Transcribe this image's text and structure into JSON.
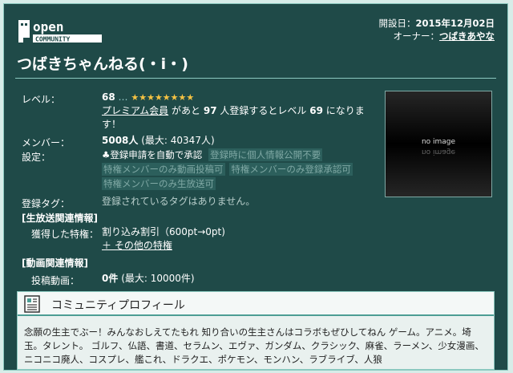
{
  "header": {
    "logo_top": "open",
    "logo_bottom": "COMMUNITY",
    "opened_label": "開設日：",
    "opened_value": "2015年12月02日",
    "owner_label": "オーナー：",
    "owner_value": "つばきあやな"
  },
  "title": "つばきちゃんねる(・i・)",
  "level": {
    "label": "レベル：",
    "value": "68",
    "dots": "…",
    "stars": "★★★★★★★★",
    "line2_link": "プレミアム会員",
    "line2_text_a": "があと",
    "line2_num": "97",
    "line2_text_b": "人登録するとレベル",
    "line2_level": "69",
    "line2_text_c": "になりま",
    "line3": "す！"
  },
  "members": {
    "label": "メンバー：",
    "value": "5008人",
    "max": "(最大: 40347人)"
  },
  "settings": {
    "label": "設定：",
    "chips": [
      {
        "text": "登録申請を自動で承認",
        "active": true
      },
      {
        "text": "登録時に個人情報公開不要",
        "active": false
      },
      {
        "text": "特権メンバーのみ動画投稿可",
        "active": false
      },
      {
        "text": "特権メンバーのみ登録承認可",
        "active": false
      },
      {
        "text": "特権メンバーのみ生放送可",
        "active": false
      }
    ]
  },
  "tags": {
    "label": "登録タグ：",
    "value": "登録されているタグはありません。"
  },
  "live": {
    "section": "[生放送関連情報]",
    "label": "獲得した特権：",
    "value": "割り込み割引（600pt→0pt)",
    "more": "＋ その他の特権"
  },
  "video": {
    "section": "[動画関連情報]",
    "label": "投稿動画：",
    "value": "0件",
    "max": "(最大: 10000件)"
  },
  "thumbnail": {
    "text": "no image"
  },
  "profile": {
    "title": "コミュニティプロフィール",
    "text": "念願の生主でぶー！みんなおしえてたもれ 知り合いの生主さんはコラボもぜひしてねん ゲーム。アニメ。埼玉。タレント。 ゴルフ、仏語、書道、セラムン、エヴァ、ガンダム、クラシック、麻雀、ラーメン、少女漫画、ニコニコ廃人、コスプレ、艦これ、ドラクエ、ポケモン、モンハン、ラブライブ、人狼"
  },
  "colors": {
    "background": "#1f4a48",
    "star": "#f6c343",
    "accent": "#4c9d94"
  }
}
